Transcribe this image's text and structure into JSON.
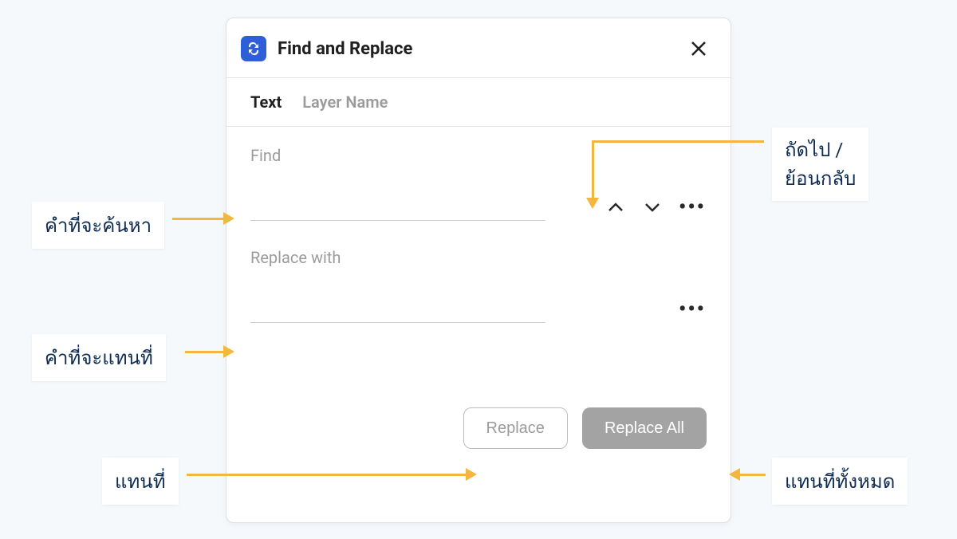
{
  "dialog": {
    "title": "Find and Replace",
    "tabs": {
      "text": "Text",
      "layer_name": "Layer Name"
    },
    "find_label": "Find",
    "find_value": "",
    "replace_label": "Replace with",
    "replace_value": "",
    "replace_button": "Replace",
    "replace_all_button": "Replace All"
  },
  "annotations": {
    "find_input": "คำที่จะค้นหา",
    "replace_input": "คำที่จะแทนที่",
    "replace_btn": "แทนที่",
    "replace_all_btn": "แทนที่ทั้งหมด",
    "nav_buttons": "ถัดไป /\nย้อนกลับ"
  }
}
